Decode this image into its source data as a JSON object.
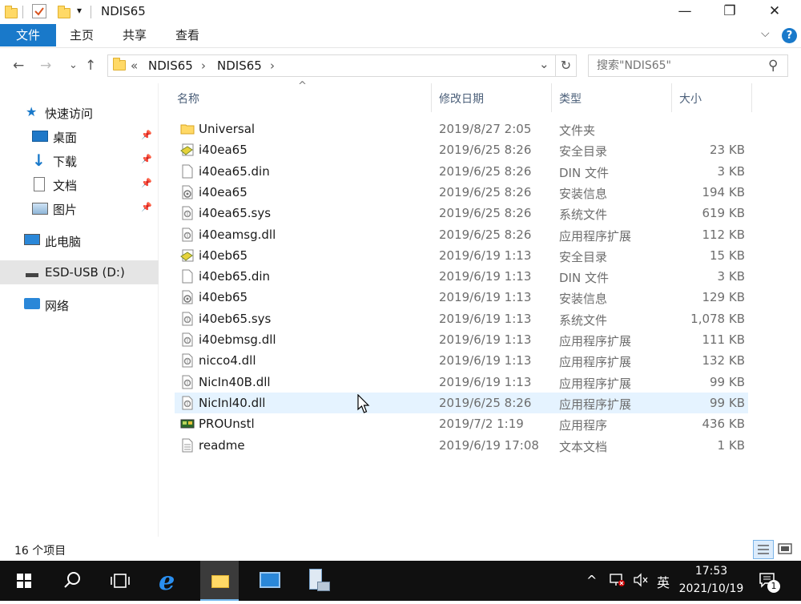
{
  "window": {
    "title": "NDIS65",
    "minimize_glyph": "—",
    "maximize_glyph": "❐",
    "close_glyph": "✕"
  },
  "ribbon": {
    "tabs": [
      {
        "label": "文件"
      },
      {
        "label": "主页"
      },
      {
        "label": "共享"
      },
      {
        "label": "查看"
      }
    ],
    "collapse_glyph": "⌵",
    "help_glyph": "?"
  },
  "nav": {
    "back": "←",
    "forward": "→",
    "recent": "⌄",
    "up": "↑",
    "breadcrumb_prefix": "«",
    "crumbs": [
      "NDIS65",
      "NDIS65"
    ],
    "sep": "›",
    "dropdown": "⌄",
    "refresh": "↻",
    "search_placeholder": "搜索\"NDIS65\"",
    "search_icon": "⚲"
  },
  "sidebar": {
    "items": [
      {
        "label": "快速访问",
        "icon": "star-icon"
      },
      {
        "label": "桌面",
        "icon": "desktop-icon",
        "pinned": true
      },
      {
        "label": "下载",
        "icon": "download-icon",
        "pinned": true
      },
      {
        "label": "文档",
        "icon": "document-icon",
        "pinned": true
      },
      {
        "label": "图片",
        "icon": "picture-icon",
        "pinned": true
      },
      {
        "label": "此电脑",
        "icon": "computer-icon"
      },
      {
        "label": "ESD-USB (D:)",
        "icon": "usb-drive-icon",
        "selected": true
      },
      {
        "label": "网络",
        "icon": "network-icon"
      }
    ],
    "pin_glyph": "📌"
  },
  "columns": {
    "name": "名称",
    "date": "修改日期",
    "type": "类型",
    "size": "大小",
    "sort_glyph": "^"
  },
  "files": [
    {
      "name": "Universal",
      "date": "2019/8/27 2:05",
      "type": "文件夹",
      "size": "",
      "icon": "folder"
    },
    {
      "name": "i40ea65",
      "date": "2019/6/25 8:26",
      "type": "安全目录",
      "size": "23 KB",
      "icon": "catalog"
    },
    {
      "name": "i40ea65.din",
      "date": "2019/6/25 8:26",
      "type": "DIN 文件",
      "size": "3 KB",
      "icon": "blank"
    },
    {
      "name": "i40ea65",
      "date": "2019/6/25 8:26",
      "type": "安装信息",
      "size": "194 KB",
      "icon": "setup"
    },
    {
      "name": "i40ea65.sys",
      "date": "2019/6/25 8:26",
      "type": "系统文件",
      "size": "619 KB",
      "icon": "system"
    },
    {
      "name": "i40eamsg.dll",
      "date": "2019/6/25 8:26",
      "type": "应用程序扩展",
      "size": "112 KB",
      "icon": "system"
    },
    {
      "name": "i40eb65",
      "date": "2019/6/19 1:13",
      "type": "安全目录",
      "size": "15 KB",
      "icon": "catalog"
    },
    {
      "name": "i40eb65.din",
      "date": "2019/6/19 1:13",
      "type": "DIN 文件",
      "size": "3 KB",
      "icon": "blank"
    },
    {
      "name": "i40eb65",
      "date": "2019/6/19 1:13",
      "type": "安装信息",
      "size": "129 KB",
      "icon": "setup"
    },
    {
      "name": "i40eb65.sys",
      "date": "2019/6/19 1:13",
      "type": "系统文件",
      "size": "1,078 KB",
      "icon": "system"
    },
    {
      "name": "i40ebmsg.dll",
      "date": "2019/6/19 1:13",
      "type": "应用程序扩展",
      "size": "111 KB",
      "icon": "system"
    },
    {
      "name": "nicco4.dll",
      "date": "2019/6/19 1:13",
      "type": "应用程序扩展",
      "size": "132 KB",
      "icon": "system"
    },
    {
      "name": "NicIn40B.dll",
      "date": "2019/6/19 1:13",
      "type": "应用程序扩展",
      "size": "99 KB",
      "icon": "system"
    },
    {
      "name": "NicInl40.dll",
      "date": "2019/6/25 8:26",
      "type": "应用程序扩展",
      "size": "99 KB",
      "icon": "system",
      "hover": true
    },
    {
      "name": "PROUnstl",
      "date": "2019/7/2 1:19",
      "type": "应用程序",
      "size": "436 KB",
      "icon": "exe"
    },
    {
      "name": "readme",
      "date": "2019/6/19 17:08",
      "type": "文本文档",
      "size": "1 KB",
      "icon": "text"
    }
  ],
  "status": {
    "item_count": "16 个项目"
  },
  "taskbar": {
    "time": "17:53",
    "date": "2021/10/19",
    "ime": "英",
    "tray_up": "^",
    "notification_count": "1"
  },
  "colors": {
    "accent": "#1979ca",
    "hover_row": "#e5f3ff",
    "taskbar": "#101010"
  }
}
